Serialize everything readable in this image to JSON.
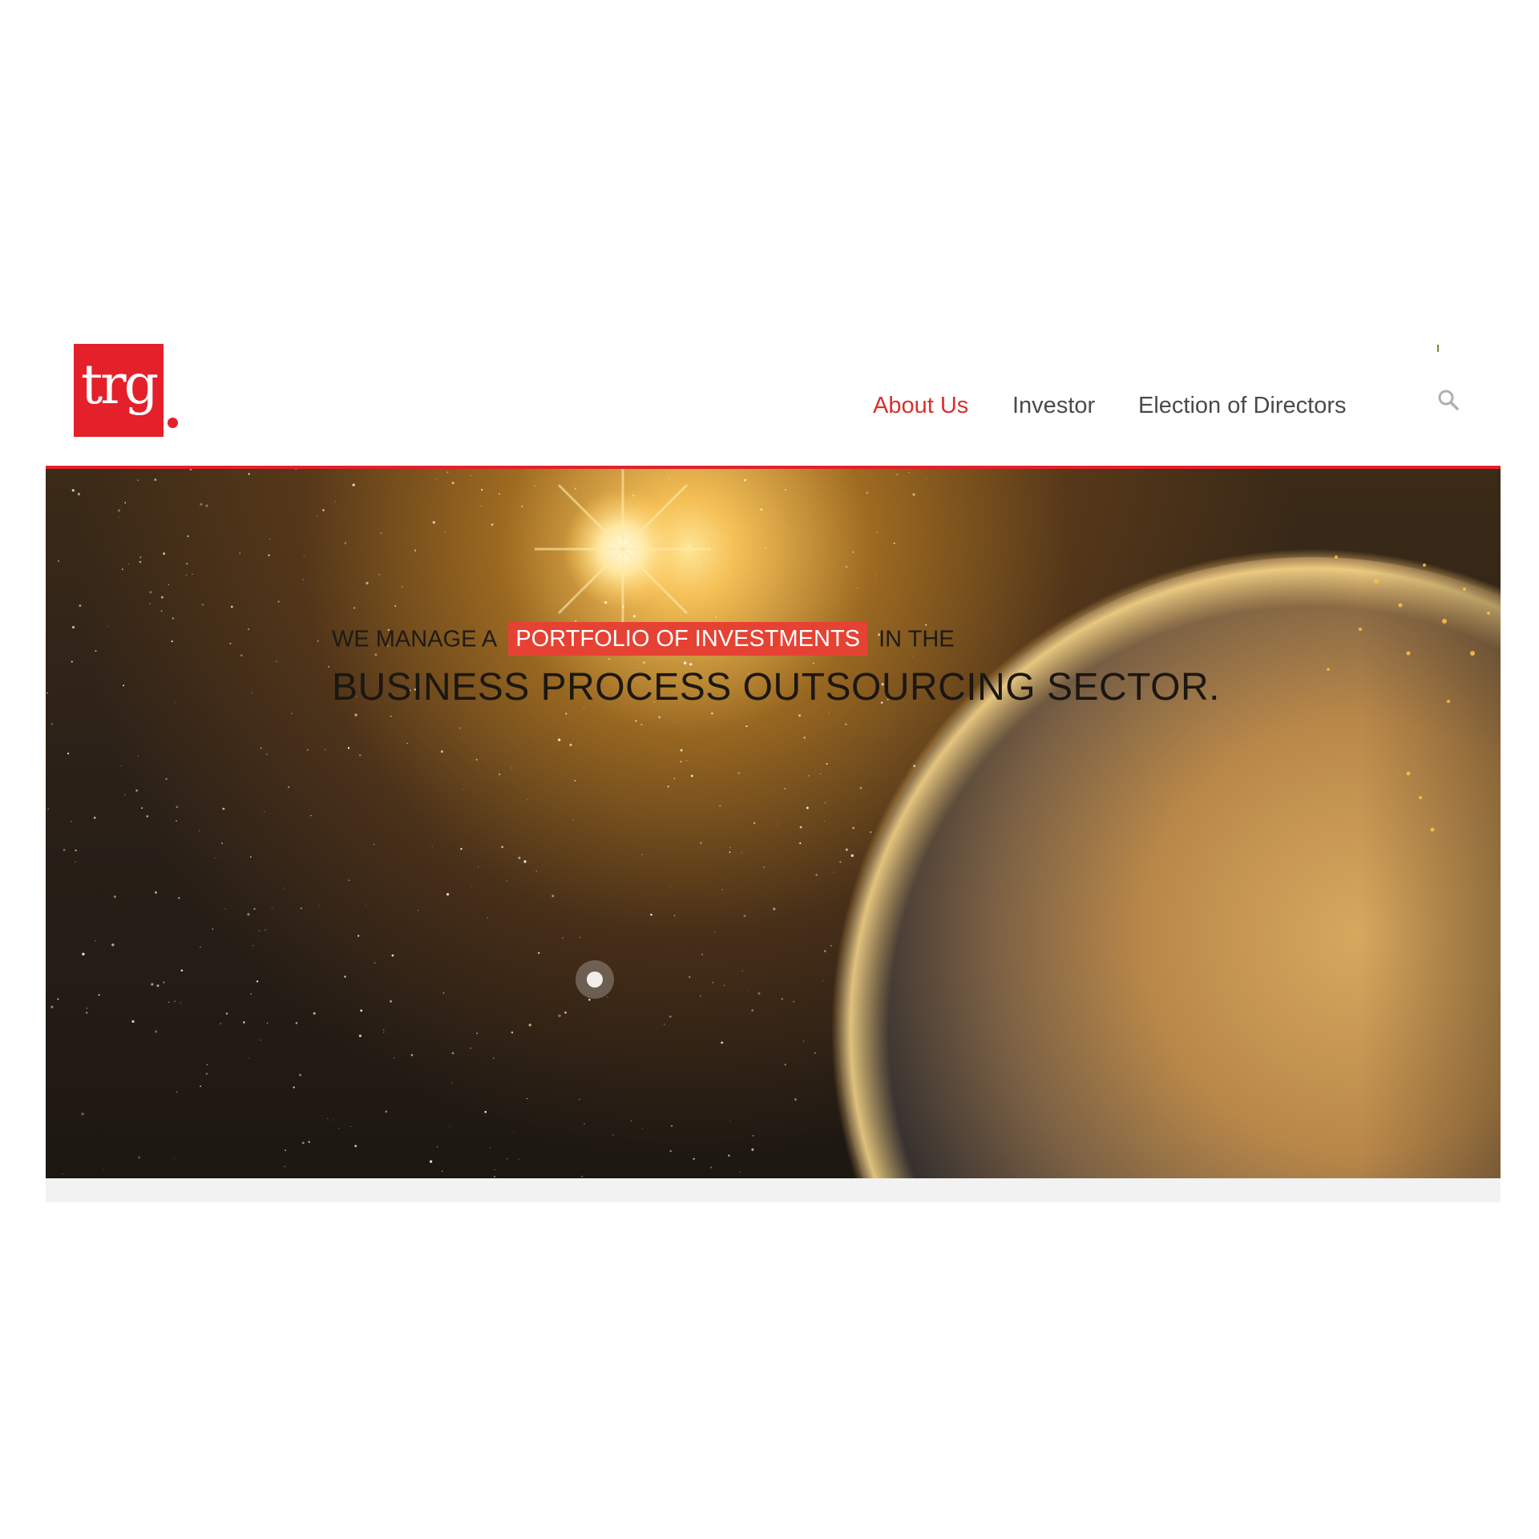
{
  "brand": {
    "logo_text": "trg"
  },
  "nav": {
    "items": [
      {
        "label": "About Us",
        "active": true
      },
      {
        "label": "Investor",
        "active": false
      },
      {
        "label": "Election of Directors",
        "active": false
      }
    ],
    "search_icon": "search-icon"
  },
  "hero": {
    "line1_before": "WE MANAGE A",
    "line1_highlight": "PORTFOLIO OF INVESTMENTS",
    "line1_after": "IN THE",
    "line2": "BUSINESS PROCESS OUTSOURCING SECTOR."
  },
  "colors": {
    "brand_red": "#e4202a",
    "nav_active": "#d9302c",
    "highlight": "#e64234"
  }
}
